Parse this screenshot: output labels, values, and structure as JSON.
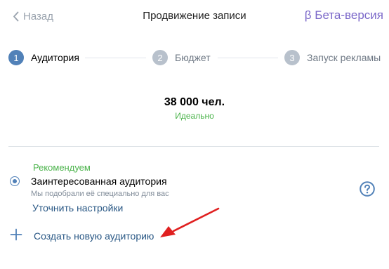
{
  "header": {
    "back_label": "Назад",
    "title": "Продвижение записи",
    "beta_label": "β Бета-версия"
  },
  "stepper": {
    "steps": [
      {
        "number": "1",
        "label": "Аудитория",
        "state": "active"
      },
      {
        "number": "2",
        "label": "Бюджет",
        "state": "inactive"
      },
      {
        "number": "3",
        "label": "Запуск рекламы",
        "state": "inactive"
      }
    ]
  },
  "stats": {
    "count": "38 000 чел.",
    "quality": "Идеально"
  },
  "audience": {
    "recommended_label": "Рекомендуем",
    "option_title": "Заинтересованная аудитория",
    "option_description": "Мы подобрали её специально для вас",
    "refine_link": "Уточнить настройки",
    "selected": true
  },
  "create": {
    "label": "Создать новую аудиторию"
  },
  "icons": {
    "back": "chevron-left-icon",
    "help": "question-circle-icon",
    "plus": "plus-icon",
    "arrow": "red-arrow-annotation-icon"
  },
  "colors": {
    "accent": "#5181b8",
    "link": "#2a5885",
    "beta": "#7b68c9",
    "success": "#4bb34b",
    "inactive_step": "#b8c1cc",
    "annotation": "#e02020"
  }
}
